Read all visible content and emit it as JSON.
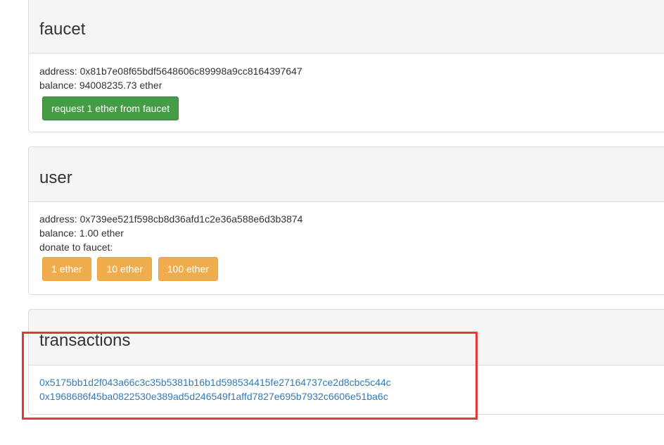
{
  "faucet": {
    "title": "faucet",
    "address_label": "address:",
    "address": "0x81b7e08f65bdf5648606c89998a9cc8164397647",
    "balance_label": "balance:",
    "balance": "94008235.73 ether",
    "request_button": "request 1 ether from faucet"
  },
  "user": {
    "title": "user",
    "address_label": "address:",
    "address": "0x739ee521f598cb8d36afd1c2e36a588e6d3b3874",
    "balance_label": "balance:",
    "balance": "1.00 ether",
    "donate_label": "donate to faucet:",
    "donate_buttons": [
      "1 ether",
      "10 ether",
      "100 ether"
    ]
  },
  "transactions": {
    "title": "transactions",
    "items": [
      "0x5175bb1d2f043a66c3c35b5381b16b1d598534415fe27164737ce2d8cbc5c44c",
      "0x1968686f45ba0822530e389ad5d246549f1affd7827e695b7932c6606e51ba6c"
    ]
  },
  "colors": {
    "success_button": "#449d44",
    "warning_button": "#f0ad4e",
    "link": "#337ab7",
    "highlight": "#e53935",
    "panel_heading_bg": "#f5f5f5"
  }
}
